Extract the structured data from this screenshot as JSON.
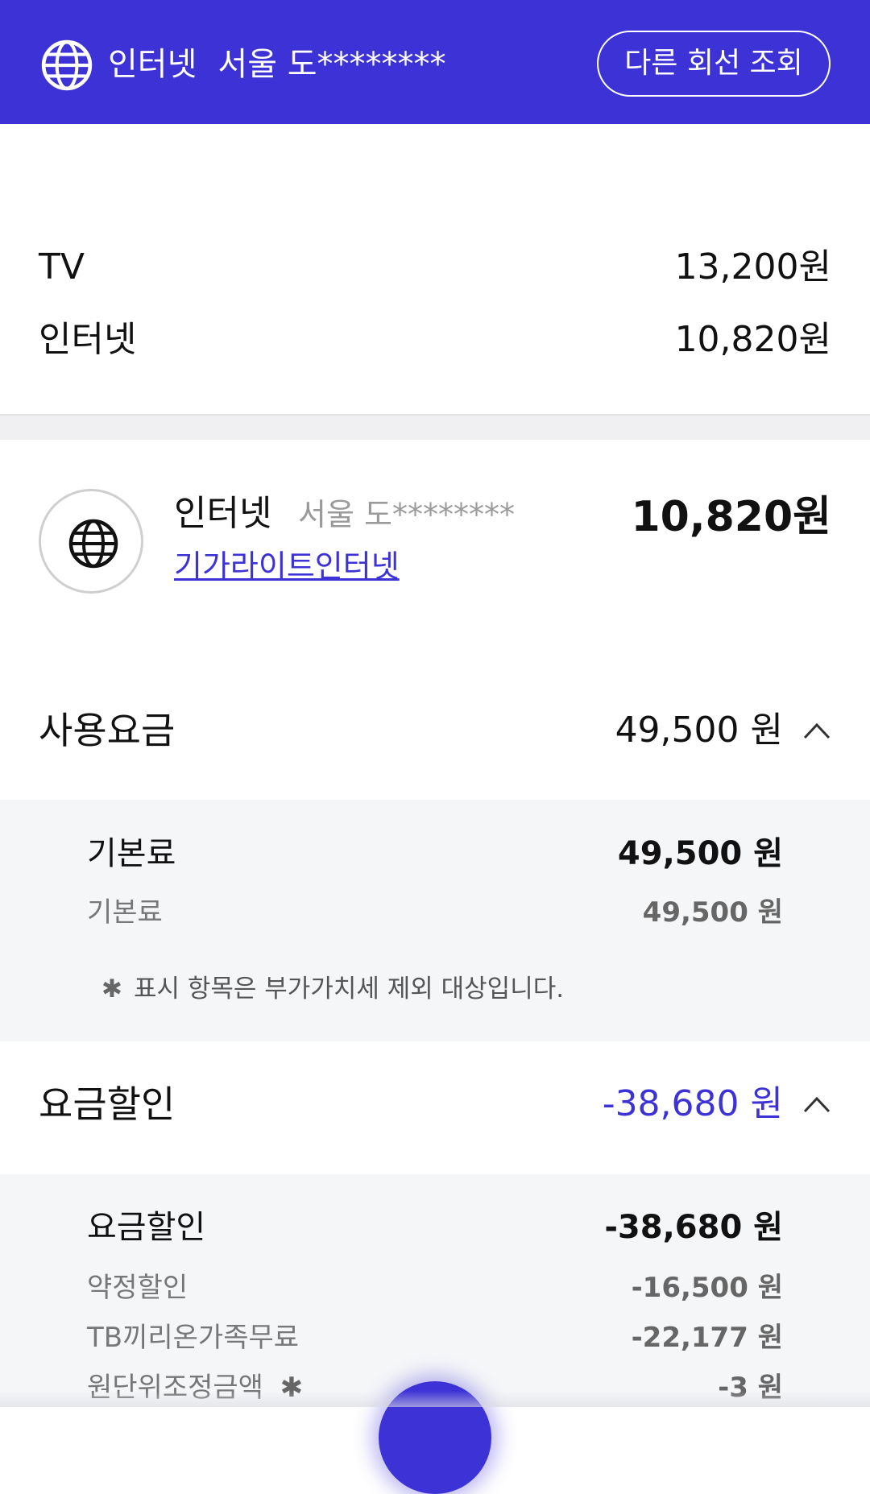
{
  "header": {
    "service": "인터넷",
    "address": "서울 도********",
    "other_line_button": "다른 회선 조회",
    "bg_color": "#3d32d6"
  },
  "summary": [
    {
      "label": "TV",
      "value": "13,200원"
    },
    {
      "label": "인터넷",
      "value": "10,820원"
    }
  ],
  "line": {
    "icon": "globe-icon",
    "service": "인터넷",
    "address": "서울 도********",
    "plan": "기가라이트인터넷",
    "amount": "10,820원"
  },
  "usage": {
    "title": "사용요금",
    "amount": "49,500 원",
    "items": [
      {
        "label": "기본료",
        "value": "49,500 원"
      },
      {
        "label": "기본료",
        "value": "49,500 원"
      }
    ],
    "note_mark": "✱",
    "note": "표시 항목은 부가가치세 제외 대상입니다."
  },
  "discount": {
    "title": "요금할인",
    "amount": "-38,680 원",
    "accent_color": "#3d32d6",
    "items": [
      {
        "label": "요금할인",
        "value": "-38,680 원"
      },
      {
        "label": "약정할인",
        "value": "-16,500 원"
      },
      {
        "label": "TB끼리온가족무료",
        "value": "-22,177 원"
      },
      {
        "label": "원단위조정금액",
        "mark": "✱",
        "value": "-3 원"
      }
    ]
  }
}
